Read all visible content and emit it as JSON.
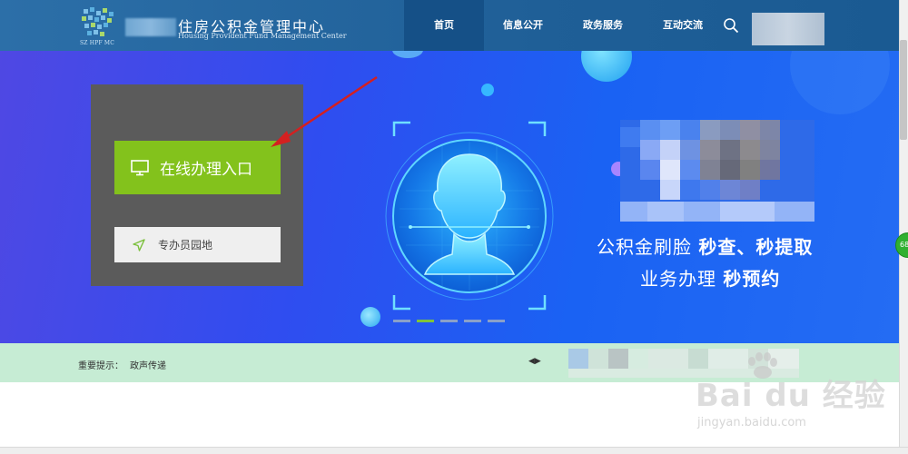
{
  "header": {
    "title": "住房公积金管理中心",
    "subtitle": "Housing Provident Fund Management Center",
    "logo_text": "SZ HPF MC"
  },
  "nav": {
    "items": [
      {
        "label": "首页",
        "active": true
      },
      {
        "label": "信息公开",
        "active": false
      },
      {
        "label": "政务服务",
        "active": false
      },
      {
        "label": "互动交流",
        "active": false
      }
    ]
  },
  "banner": {
    "online_button": "在线办理入口",
    "staff_button": "专办员园地",
    "slogan_line1_normal": "公积金刷脸",
    "slogan_line1_bold": "秒查、秒提取",
    "slogan_line2_normal": "业务办理",
    "slogan_line2_bold": "秒预约",
    "carousel_count": 5,
    "carousel_active_index": 1
  },
  "tips": {
    "label": "重要提示：",
    "text": "政声传递",
    "arrows": "◀▶"
  },
  "float_badge": "68",
  "watermark": {
    "brand": "Bai du 经验",
    "url": "jingyan.baidu.com"
  },
  "colors": {
    "header_bg": "#1f5f97",
    "nav_active_bg": "#155087",
    "banner_blue": "#1a62f3",
    "panel_bg": "#5b5b5b",
    "online_green": "#83c21c",
    "tips_bg": "#c6ecd4",
    "annotation_red": "#d42020"
  }
}
